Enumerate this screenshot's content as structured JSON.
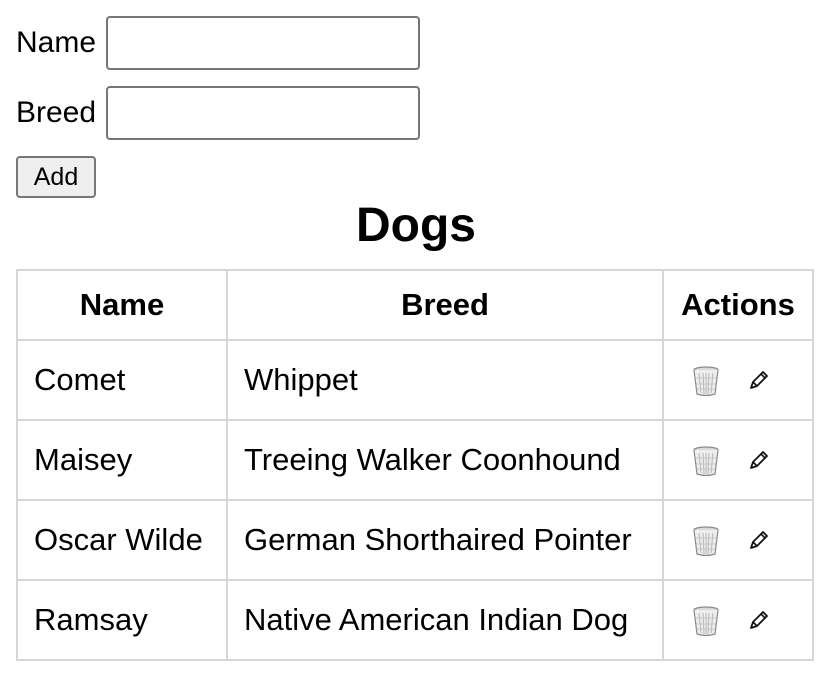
{
  "form": {
    "name_label": "Name",
    "name_value": "",
    "breed_label": "Breed",
    "breed_value": "",
    "add_button": "Add"
  },
  "title": "Dogs",
  "table": {
    "headers": [
      "Name",
      "Breed",
      "Actions"
    ],
    "rows": [
      {
        "name": "Comet",
        "breed": "Whippet"
      },
      {
        "name": "Maisey",
        "breed": "Treeing Walker Coonhound"
      },
      {
        "name": "Oscar Wilde",
        "breed": "German Shorthaired Pointer"
      },
      {
        "name": "Ramsay",
        "breed": "Native American Indian Dog"
      }
    ],
    "row_action_icons": [
      "trash-icon",
      "pencil-icon"
    ]
  }
}
